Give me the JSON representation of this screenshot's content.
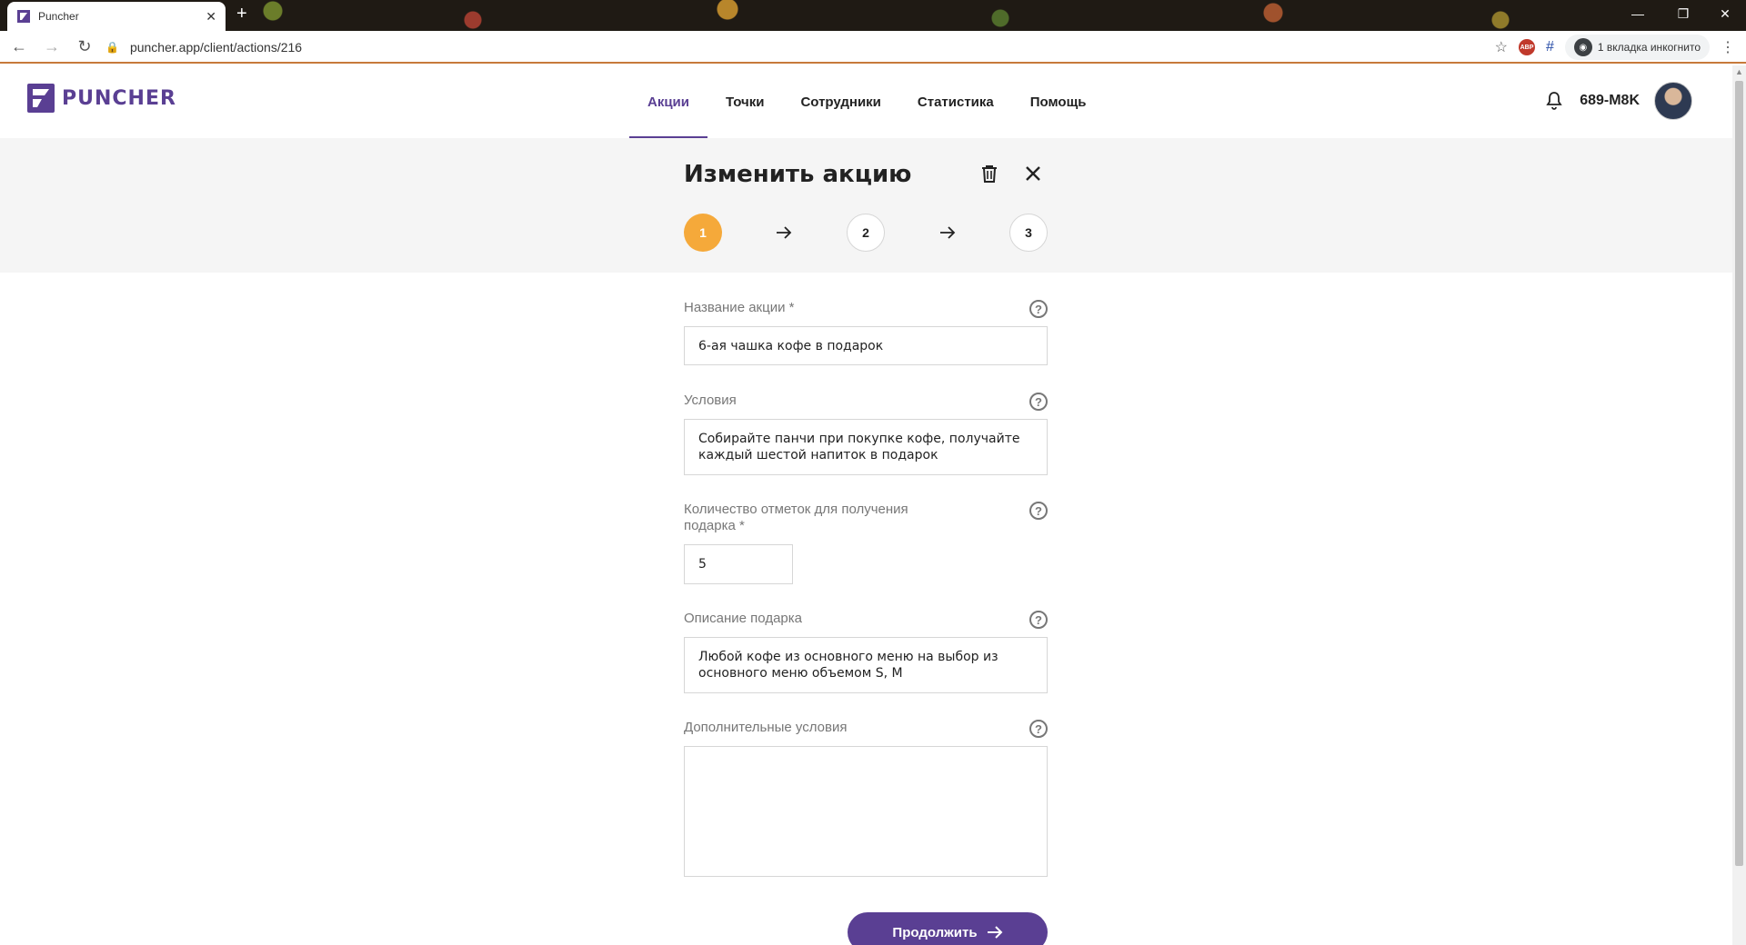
{
  "browser": {
    "tab_title": "Puncher",
    "url": "puncher.app/client/actions/216",
    "incognito_label": "1 вкладка инкогнито",
    "abp_label": "ABP"
  },
  "app": {
    "logo_text": "PUNCHER",
    "nav": [
      {
        "label": "Акции",
        "active": true
      },
      {
        "label": "Точки",
        "active": false
      },
      {
        "label": "Сотрудники",
        "active": false
      },
      {
        "label": "Статистика",
        "active": false
      },
      {
        "label": "Помощь",
        "active": false
      }
    ],
    "username": "689-M8K",
    "brand_color": "#5a3f93",
    "accent_color": "#f5a93a"
  },
  "editor": {
    "title": "Изменить акцию",
    "steps": [
      "1",
      "2",
      "3"
    ],
    "active_step": 1,
    "fields": {
      "name": {
        "label": "Название акции *",
        "value": "6-ая чашка кофе в подарок"
      },
      "conditions": {
        "label": "Условия",
        "value": "Собирайте панчи при покупке кофе, получайте\nкаждый шестой напиток в подарок"
      },
      "count": {
        "label": "Количество отметок для получения\nподарка *",
        "value": "5"
      },
      "gift": {
        "label": "Описание подарка",
        "value": "Любой кофе из основного меню на выбор из\nосновного меню объемом S, M"
      },
      "extra": {
        "label": "Дополнительные условия",
        "value": ""
      }
    },
    "help_glyph": "?",
    "continue_label": "Продолжить"
  }
}
